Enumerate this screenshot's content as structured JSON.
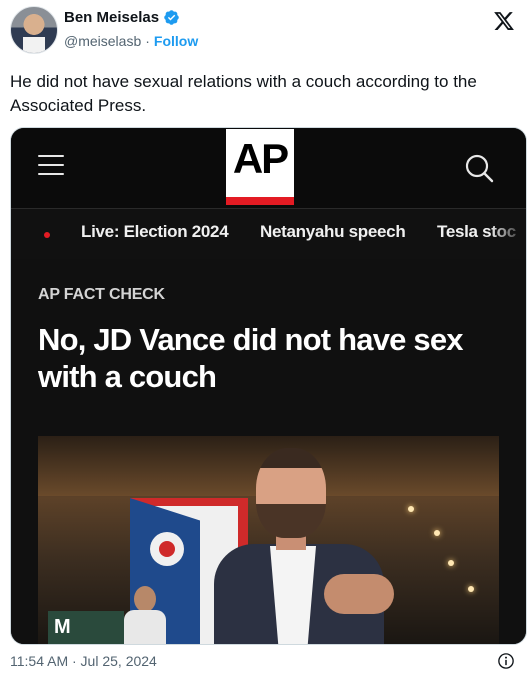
{
  "author": {
    "display_name": "Ben Meiselas",
    "handle": "@meiselasb",
    "separator": "·",
    "follow_label": "Follow",
    "verified_color": "#1d9bf0"
  },
  "tweet": {
    "text": "He did not have sexual relations with a couch according to the Associated Press.",
    "timestamp": "11:54 AM · Jul 25, 2024"
  },
  "embedded_image": {
    "logo_text": "AP",
    "trending": {
      "items": [
        "Live: Election 2024",
        "Netanyahu speech",
        "Tesla stoc"
      ]
    },
    "kicker": "AP FACT CHECK",
    "headline": "No, JD Vance did not have sex with a couch",
    "sign_text": "M",
    "brand_red": "#e31b23"
  },
  "icons": [
    "x-logo-icon",
    "verified-badge-icon",
    "hamburger-menu-icon",
    "search-icon",
    "info-icon"
  ]
}
